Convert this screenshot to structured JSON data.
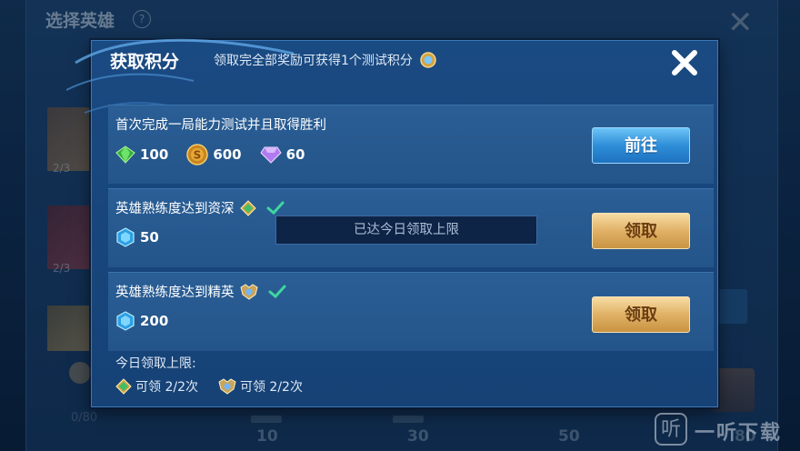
{
  "background": {
    "title": "选择英雄",
    "help_glyph": "?",
    "hero_counts": [
      "2/3",
      "2/3"
    ],
    "progress_start": "0/80",
    "progress_marks": [
      "10",
      "30",
      "50",
      "80"
    ]
  },
  "watermark": {
    "icon_glyph": "听",
    "text": "一听下载"
  },
  "dialog": {
    "title": "获取积分",
    "subtitle": "领取完全部奖励可获得1个测试积分",
    "tasks": [
      {
        "title": "首次完成一局能力测试并且取得胜利",
        "rewards": [
          {
            "icon": "emerald-gem-icon",
            "value": "100"
          },
          {
            "icon": "gold-coin-icon",
            "value": "600"
          },
          {
            "icon": "purple-diamond-icon",
            "value": "60"
          }
        ],
        "button": "前往",
        "button_style": "blue"
      },
      {
        "title": "英雄熟练度达到资深",
        "badge": "veteran-badge-icon",
        "completed": true,
        "rewards": [
          {
            "icon": "blue-crystal-icon",
            "value": "50"
          }
        ],
        "button": "领取",
        "button_style": "gold"
      },
      {
        "title": "英雄熟练度达到精英",
        "badge": "elite-badge-icon",
        "completed": true,
        "rewards": [
          {
            "icon": "blue-crystal-icon",
            "value": "200"
          }
        ],
        "button": "领取",
        "button_style": "gold"
      }
    ],
    "toast": "已达今日领取上限",
    "daily_limit": {
      "title": "今日领取上限:",
      "items": [
        {
          "icon": "veteran-badge-icon",
          "text": "可领 2/2次"
        },
        {
          "icon": "elite-badge-icon",
          "text": "可领 2/2次"
        }
      ]
    }
  },
  "colors": {
    "dialog_bg": "#1a4a82",
    "card_bg": "#2a5e95",
    "button_blue": "#2e8ed8",
    "button_gold": "#e0b166",
    "check_green": "#3fd6a0"
  }
}
